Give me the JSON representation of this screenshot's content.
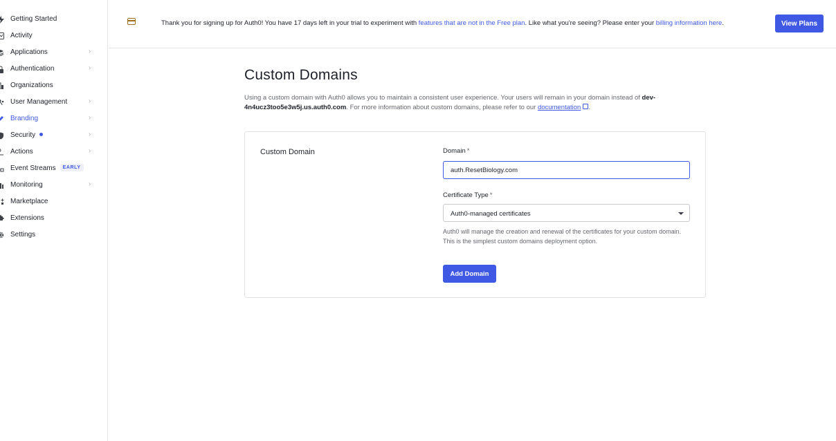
{
  "sidebar": {
    "items": [
      {
        "label": "Getting Started",
        "icon": "bolt-icon",
        "chevron": false
      },
      {
        "label": "Activity",
        "icon": "activity-icon",
        "chevron": false
      },
      {
        "label": "Applications",
        "icon": "layers-icon",
        "chevron": true
      },
      {
        "label": "Authentication",
        "icon": "lock-icon",
        "chevron": true
      },
      {
        "label": "Organizations",
        "icon": "building-icon",
        "chevron": false
      },
      {
        "label": "User Management",
        "icon": "users-icon",
        "chevron": true
      },
      {
        "label": "Branding",
        "icon": "pen-icon",
        "chevron": true,
        "active": true
      },
      {
        "label": "Security",
        "icon": "shield-icon",
        "chevron": true,
        "dot": true
      },
      {
        "label": "Actions",
        "icon": "actions-icon",
        "chevron": true
      },
      {
        "label": "Event Streams",
        "icon": "stream-icon",
        "chevron": false,
        "badge": "EARLY"
      },
      {
        "label": "Monitoring",
        "icon": "bar-chart-icon",
        "chevron": true
      },
      {
        "label": "Marketplace",
        "icon": "grid-plus-icon",
        "chevron": false
      },
      {
        "label": "Extensions",
        "icon": "puzzle-icon",
        "chevron": false
      },
      {
        "label": "Settings",
        "icon": "gear-icon",
        "chevron": false
      }
    ]
  },
  "banner": {
    "text_before": "Thank you for signing up for Auth0! You have 17 days left in your trial to experiment with ",
    "link1": "features that are not in the Free plan",
    "text_middle": ". Like what you're seeing? Please enter your ",
    "link2": "billing information here",
    "text_after": ".",
    "button": "View Plans"
  },
  "main": {
    "title": "Custom Domains",
    "desc_before": "Using a custom domain with Auth0 allows you to maintain a consistent user experience. Your users will remain in your domain instead of ",
    "desc_domain": "dev-4n4ucz3too5e3w5j.us.auth0.com",
    "desc_after": ". For more information about custom domains, please refer to our ",
    "desc_link": "documentation",
    "desc_end": "."
  },
  "card": {
    "title": "Custom Domain",
    "domain_label": "Domain",
    "domain_value": "auth.ResetBiology.com",
    "required_mark": "*",
    "cert_label": "Certificate Type",
    "cert_value": "Auth0-managed certificates",
    "help": "Auth0 will manage the creation and renewal of the certificates for your custom domain. This is the simplest custom domains deployment option.",
    "button": "Add Domain"
  },
  "colors": {
    "accent": "#3f59e4",
    "warning_icon": "#a06d1d",
    "muted_text": "#65676e"
  }
}
